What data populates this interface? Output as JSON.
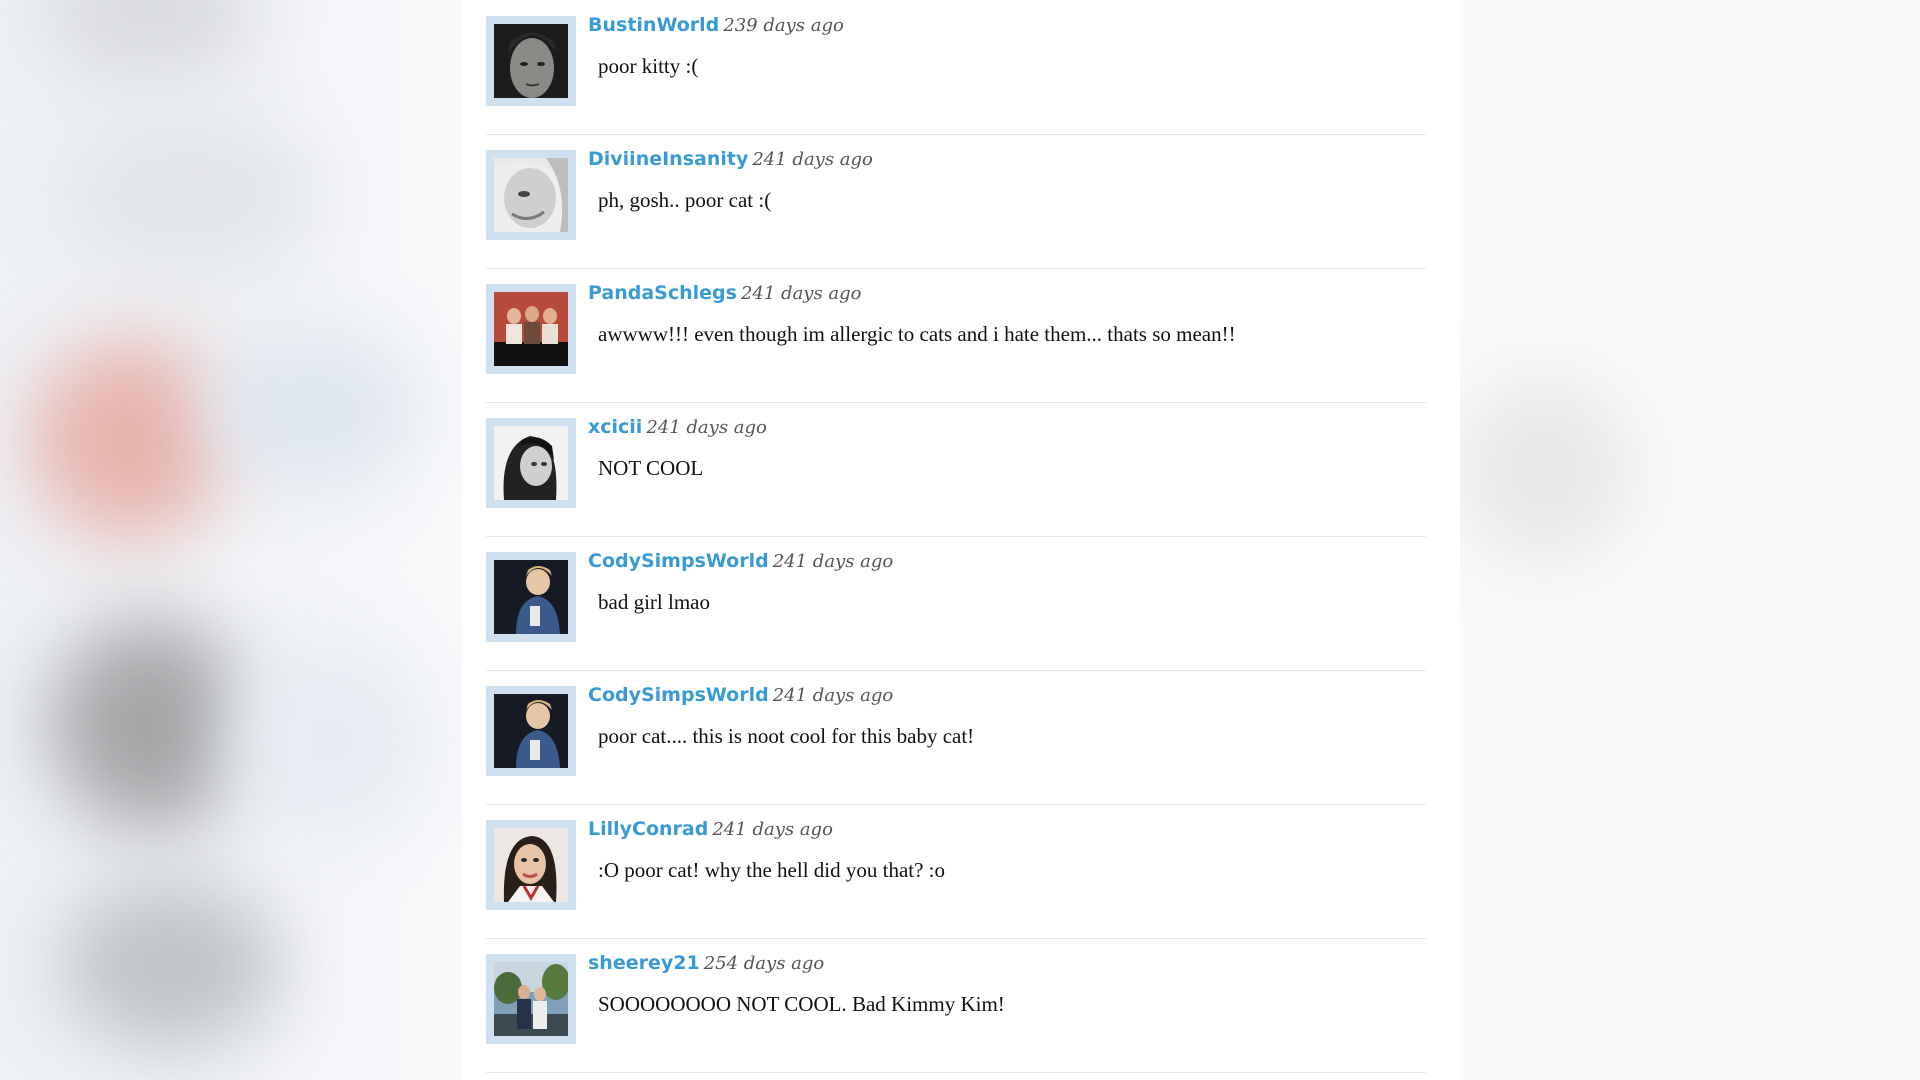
{
  "comments": [
    {
      "username": "BustinWorld",
      "time": "239 days ago",
      "text": "poor kitty :("
    },
    {
      "username": "DiviineInsanity",
      "time": "241 days ago",
      "text": "ph, gosh.. poor cat :("
    },
    {
      "username": "PandaSchlegs",
      "time": "241 days ago",
      "text": "awwww!!! even though im allergic to cats and i hate them... thats so mean!!"
    },
    {
      "username": "xcicii",
      "time": "241 days ago",
      "text": "NOT COOL"
    },
    {
      "username": "CodySimpsWorld",
      "time": "241 days ago",
      "text": "bad girl lmao"
    },
    {
      "username": "CodySimpsWorld",
      "time": "241 days ago",
      "text": "poor cat.... this is noot cool for this baby cat!"
    },
    {
      "username": "LillyConrad",
      "time": "241 days ago",
      "text": ":O poor cat! why the hell did you that? :o"
    },
    {
      "username": "sheerey21",
      "time": "254 days ago",
      "text": "SOOOOOOOO NOT COOL. Bad Kimmy Kim!"
    }
  ],
  "colors": {
    "username": "#3a9bd4",
    "avatar_frame": "#cfe1f1",
    "divider": "#e6e6e6"
  }
}
